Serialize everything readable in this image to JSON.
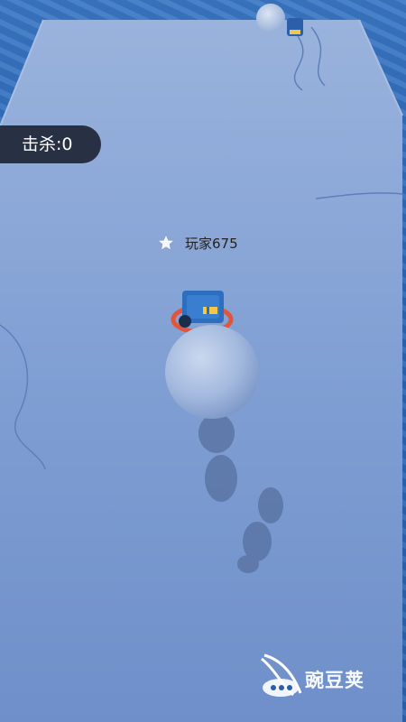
{
  "hud": {
    "kill_label": "击杀:0"
  },
  "player": {
    "name": "玩家675"
  },
  "icons": {
    "player_marker": "star-icon",
    "watermark_logo": "bean-logo-icon"
  },
  "watermark": {
    "text": "豌豆荚"
  },
  "colors": {
    "water": "#2f6cb8",
    "platform": "#7f9dd2",
    "hud_bg": "#20263a",
    "vehicle": "#2d6fbe",
    "snowball": "#a9bfe0",
    "ring": "#e2553b"
  }
}
